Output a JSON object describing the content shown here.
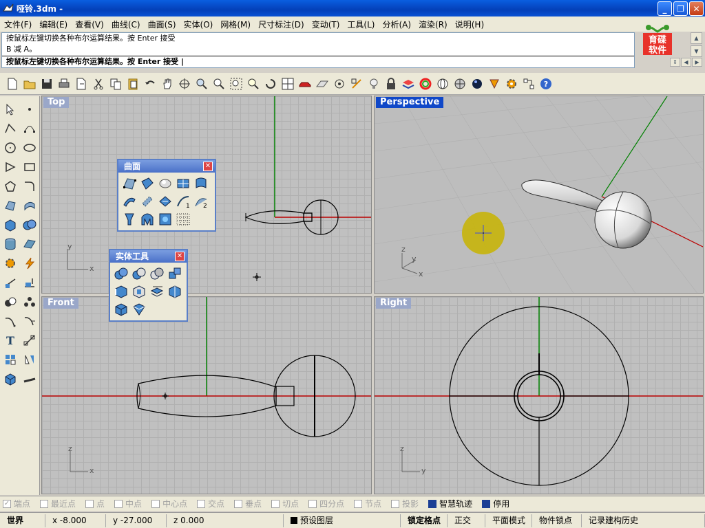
{
  "window": {
    "title": "哑铃.3dm -"
  },
  "menu": [
    "文件(F)",
    "编辑(E)",
    "查看(V)",
    "曲线(C)",
    "曲面(S)",
    "实体(O)",
    "网格(M)",
    "尺寸标注(D)",
    "变动(T)",
    "工具(L)",
    "分析(A)",
    "渲染(R)",
    "说明(H)"
  ],
  "command": {
    "history": [
      "按鼠标左键切换各种布尔运算结果。按 Enter 接受",
      "B 减 A。"
    ],
    "prompt": "按鼠标左键切换各种布尔运算结果。按 Enter 接受 |"
  },
  "logo": {
    "line1": "育碟",
    "line2": "软件"
  },
  "viewports": {
    "top": "Top",
    "perspective": "Perspective",
    "front": "Front",
    "right": "Right"
  },
  "axes": {
    "x": "x",
    "y": "y",
    "z": "z"
  },
  "panels": {
    "surface": {
      "title": "曲面"
    },
    "solid": {
      "title": "实体工具"
    }
  },
  "osnap": [
    {
      "label": "端点",
      "checked": true
    },
    {
      "label": "最近点",
      "checked": false
    },
    {
      "label": "点",
      "checked": false
    },
    {
      "label": "中点",
      "checked": false
    },
    {
      "label": "中心点",
      "checked": false
    },
    {
      "label": "交点",
      "checked": false
    },
    {
      "label": "垂点",
      "checked": false
    },
    {
      "label": "切点",
      "checked": false
    },
    {
      "label": "四分点",
      "checked": false
    },
    {
      "label": "节点",
      "checked": false
    },
    {
      "label": "投影",
      "checked": false
    },
    {
      "label": "智慧轨迹",
      "checked": true
    },
    {
      "label": "停用",
      "checked": true
    }
  ],
  "status": {
    "cplane": "世界",
    "x": "x -8.000",
    "y": "y -27.000",
    "z": "z 0.000",
    "layer": "预设图层",
    "grid_snap": "锁定格点",
    "ortho": "正交",
    "planar": "平面模式",
    "osnap": "物件锁点",
    "history": "记录建构历史"
  }
}
